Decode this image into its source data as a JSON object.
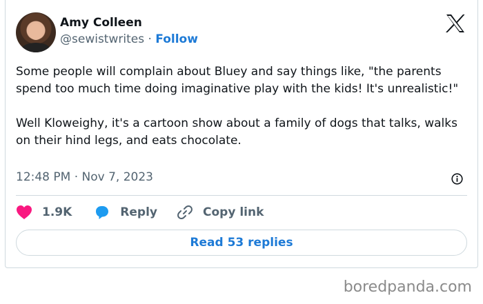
{
  "tweet": {
    "author_name": "Amy Colleen",
    "handle": "@sewistwrites",
    "separator": " · ",
    "follow_label": "Follow",
    "text": "Some people will complain about Bluey and say things like, \"the parents spend too much time doing imaginative play with the kids! It's unrealistic!\"\n\nWell Kloweighy, it's a cartoon show about a family of dogs that talks, walks on their hind legs, and eats chocolate.",
    "timestamp": "12:48 PM · Nov 7, 2023",
    "likes": "1.9K",
    "reply_label": "Reply",
    "copy_link_label": "Copy link",
    "read_replies_label": "Read 53 replies"
  },
  "icons": {
    "platform": "x-logo-icon",
    "info": "info-icon",
    "like": "heart-icon",
    "reply": "speech-bubble-icon",
    "copy": "link-icon"
  },
  "colors": {
    "like": "#f91880",
    "reply_icon": "#1d9bf0",
    "link_blue": "#1d7ad6",
    "secondary_text": "#536471"
  },
  "watermark": "boredpanda.com"
}
